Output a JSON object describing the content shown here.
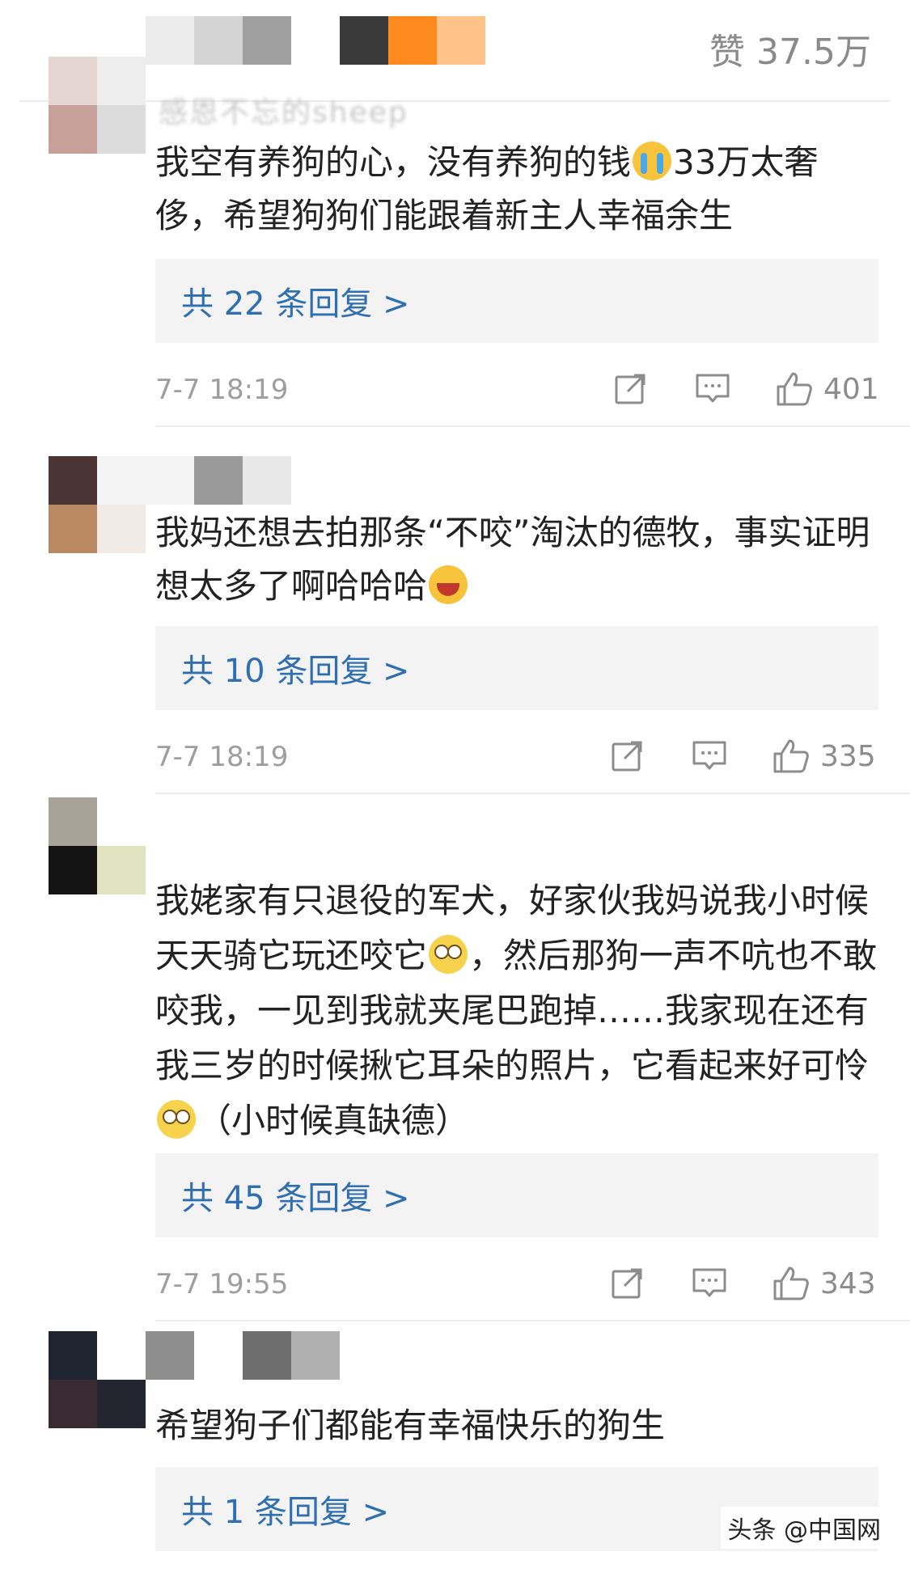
{
  "header": {
    "like_label": "赞",
    "like_total": "37.5万"
  },
  "comments": [
    {
      "username": "感恩不忘的sheep",
      "text_before": "我空有养狗的心，没有养狗的钱",
      "text_after": "33万太奢侈，希望狗狗们能跟着新主人幸福余生",
      "replies": "共 22 条回复 >",
      "time": "7-7 18:19",
      "likes": "401"
    },
    {
      "username": "",
      "text_before": "我妈还想去拍那条“不咬”淘汰的德牧，事实证明想太多了啊哈哈哈",
      "text_after": "",
      "replies": "共 10 条回复 >",
      "time": "7-7 18:19",
      "likes": "335"
    },
    {
      "username": "",
      "text_1": "我姥家有只退役的军犬，好家伙我妈说我小时候天天骑它玩还咬它",
      "text_2": "，然后那狗一声不吭也不敢咬我，一见到我就夹尾巴跑掉……我家现在还有我三岁的时候揪它耳朵的照片，它看起来好可怜",
      "text_3": "（小时候真缺德）",
      "replies": "共 45 条回复 >",
      "time": "7-7 19:55",
      "likes": "343"
    },
    {
      "username": "",
      "text_before": "希望狗子们都能有幸福快乐的狗生",
      "replies": "共 1 条回复 >"
    }
  ],
  "watermark": "头条 @中国网",
  "icons": [
    "share-icon",
    "comment-icon",
    "thumbs-up-icon"
  ],
  "colors": {
    "reply_link": "#2f6fb1",
    "meta_text": "#9e9e9e",
    "reply_bg": "#f3f3f3"
  }
}
